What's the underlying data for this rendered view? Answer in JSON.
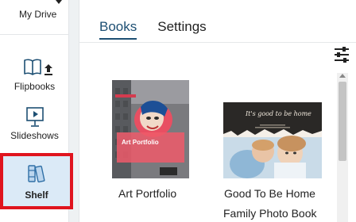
{
  "sidebar": {
    "my_drive_label": "My Drive",
    "flipbooks_label": "Flipbooks",
    "slideshows_label": "Slideshows",
    "shelf_label": "Shelf"
  },
  "tabs": [
    {
      "label": "Books",
      "active": true
    },
    {
      "label": "Settings",
      "active": false
    }
  ],
  "books": [
    {
      "title": "Art Portfolio",
      "cover_text": "Art Portfolio"
    },
    {
      "title_line1": "Good To Be Home",
      "title_line2": "Family Photo Book",
      "cover_text": "It's good to be home"
    }
  ],
  "colors": {
    "accent": "#1d4f73",
    "active_highlight": "#dbeaf7",
    "selection_border": "#e0141e"
  }
}
